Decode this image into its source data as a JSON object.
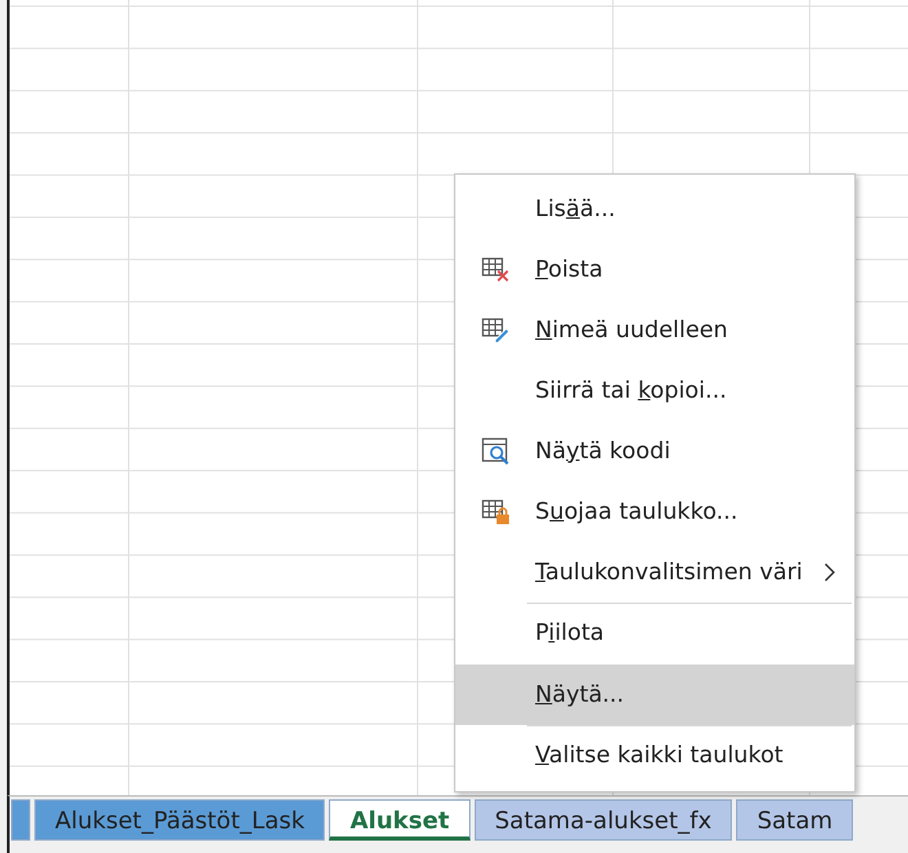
{
  "sheet_tabs": [
    {
      "selected": false,
      "color": "#5b9bd5"
    },
    {
      "label": "Alukset_Päästöt_Lask",
      "selected": false,
      "color": "#5b9bd5"
    },
    {
      "label": "Alukset",
      "selected": true,
      "color": "#ffffff"
    },
    {
      "label": "Satama-alukset_fx",
      "selected": false,
      "color": "#b4c6e7"
    },
    {
      "label": "Satam",
      "selected": false,
      "color": "#b4c6e7"
    }
  ],
  "context_menu": {
    "items": [
      {
        "label": {
          "before": "Lis",
          "key": "ä",
          "after": "ä..."
        },
        "kind": "plain",
        "submenu": false,
        "highlighted": false,
        "separator_before": false
      },
      {
        "label": {
          "key": "P",
          "after": "oista"
        },
        "kind": "delete",
        "submenu": false,
        "highlighted": false,
        "separator_before": false
      },
      {
        "label": {
          "key": "N",
          "after": "imeä uudelleen"
        },
        "kind": "rename",
        "submenu": false,
        "highlighted": false,
        "separator_before": false
      },
      {
        "label": {
          "before": "Siirrä tai ",
          "key": "k",
          "after": "opioi..."
        },
        "kind": "plain",
        "submenu": false,
        "highlighted": false,
        "separator_before": false
      },
      {
        "label": {
          "before": "Nä",
          "key": "y",
          "after": "tä koodi"
        },
        "kind": "code",
        "submenu": false,
        "highlighted": false,
        "separator_before": false
      },
      {
        "label": {
          "before": "S",
          "key": "u",
          "after": "ojaa taulukko..."
        },
        "kind": "protect",
        "submenu": false,
        "highlighted": false,
        "separator_before": false
      },
      {
        "label": {
          "key": "T",
          "after": "aulukonvalitsimen väri"
        },
        "kind": "plain",
        "submenu": true,
        "highlighted": false,
        "separator_before": false
      },
      {
        "label": {
          "before": "P",
          "key": "i",
          "after": "ilota"
        },
        "kind": "plain",
        "submenu": false,
        "highlighted": false,
        "separator_before": true
      },
      {
        "label": {
          "key": "N",
          "after": "äytä..."
        },
        "kind": "plain",
        "submenu": false,
        "highlighted": true,
        "separator_before": false
      },
      {
        "label": {
          "key": "V",
          "after": "alitse kaikki taulukot"
        },
        "kind": "plain",
        "submenu": false,
        "highlighted": false,
        "separator_before": true
      }
    ]
  }
}
